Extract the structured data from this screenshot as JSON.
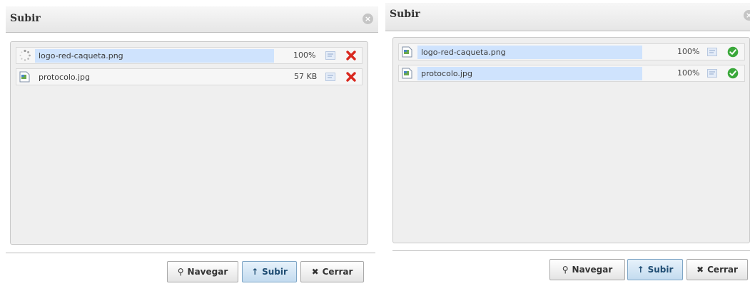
{
  "dialogs": {
    "left": {
      "title": "Subir",
      "files": [
        {
          "name": "logo-red-caqueta.png",
          "status": "100%",
          "icon": "spinner-icon",
          "action": "remove-icon"
        },
        {
          "name": "protocolo.jpg",
          "status": "57 KB",
          "icon": "image-file-icon",
          "action": "remove-icon"
        }
      ],
      "buttons": {
        "browse": "Navegar",
        "upload": "Subir",
        "close": "Cerrar"
      }
    },
    "right": {
      "title": "Subir",
      "files": [
        {
          "name": "logo-red-caqueta.png",
          "status": "100%",
          "icon": "image-file-icon",
          "action": "success-check-icon"
        },
        {
          "name": "protocolo.jpg",
          "status": "100%",
          "icon": "image-file-icon",
          "action": "success-check-icon"
        }
      ],
      "buttons": {
        "browse": "Navegar",
        "upload": "Subir",
        "close": "Cerrar"
      }
    }
  },
  "icons": {
    "close": "×",
    "browse": "⚲",
    "upload": "↑",
    "cancel": "✖"
  },
  "colors": {
    "highlight": "#cfe3fd",
    "remove": "#d9281f",
    "success": "#3aa83a",
    "primary_button": "#c3dbef"
  }
}
